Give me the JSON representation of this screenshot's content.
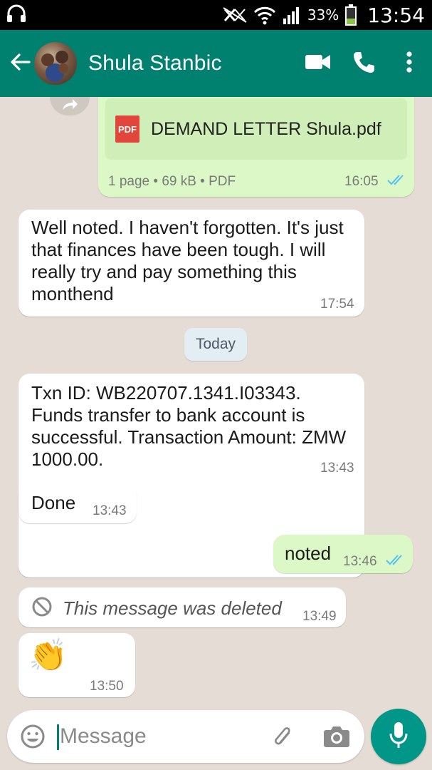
{
  "status_bar": {
    "battery_percent": "33%",
    "time": "13:54",
    "icons": [
      "headphones-icon",
      "mute-icon",
      "wifi-icon",
      "signal-icon",
      "battery-icon"
    ]
  },
  "header": {
    "contact_name": "Shula Stanbic",
    "icons": [
      "back-arrow-icon",
      "video-call-icon",
      "phone-icon",
      "more-vert-icon"
    ]
  },
  "messages": {
    "document": {
      "type_label": "PDF",
      "file_name": "DEMAND LETTER Shula.pdf",
      "meta": "1 page • 69 kB • PDF",
      "time": "16:05"
    },
    "m1": {
      "text": "Well noted. I haven't forgotten. It's just that finances have been tough. I will really try and pay something this monthend",
      "time": "17:54"
    },
    "day_divider": "Today",
    "m2": {
      "text": "Txn ID: WB220707.1341.I03343. Funds transfer to bank account is successful. Transaction Amount: ZMW 1000.00.",
      "time": "13:43"
    },
    "m3": {
      "text": "Done",
      "time": "13:43"
    },
    "m4": {
      "text": "noted",
      "time": "13:46"
    },
    "m5": {
      "text": "This message was deleted",
      "time": "13:49"
    },
    "m6": {
      "text": "👏",
      "time": "13:50"
    }
  },
  "composer": {
    "placeholder": "Message",
    "icons": [
      "emoji-icon",
      "attach-icon",
      "camera-icon",
      "mic-icon"
    ]
  },
  "colors": {
    "header": "#00806f",
    "outgoing_bubble": "#dcf8c6",
    "incoming_bubble": "#ffffff",
    "chat_background": "#e5ddd5",
    "read_ticks": "#4fc3f7",
    "mic_button": "#009688"
  }
}
